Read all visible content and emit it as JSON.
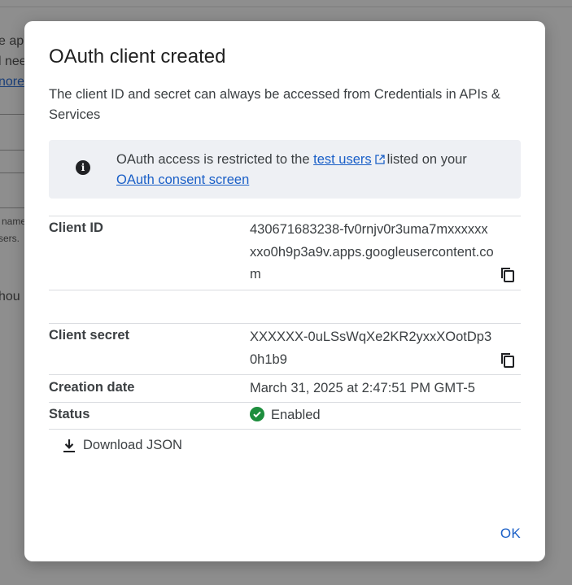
{
  "background": {
    "fragments": [
      "e ap",
      "l nee",
      "nore",
      "hou",
      "name",
      "sers."
    ]
  },
  "dialog": {
    "title": "OAuth client created",
    "description": "The client ID and secret can always be accessed from Credentials in APIs & Services",
    "notice": {
      "text_before": "OAuth access is restricted to the",
      "link1": "test users",
      "text_middle": "listed on your",
      "link2": "OAuth consent screen"
    },
    "client_id": {
      "label": "Client ID",
      "value": "430671683238-fv0rnjv0r3uma7mxxxxxxxxo0h9p3a9v.apps.googleusercontent.com"
    },
    "client_secret": {
      "label": "Client secret",
      "value": "XXXXXX-0uLSsWqXe2KR2yxxXOotDp30h1b9"
    },
    "creation_date": {
      "label": "Creation date",
      "value": "March 31, 2025 at 2:47:51 PM GMT-5"
    },
    "status": {
      "label": "Status",
      "value": "Enabled"
    },
    "download_label": "Download JSON",
    "ok_label": "OK"
  },
  "icons": {
    "info": "info-icon",
    "external_link": "external-link-icon",
    "copy": "copy-icon",
    "check": "check-circle-icon",
    "download": "download-icon"
  },
  "colors": {
    "accent": "#1a5fc7",
    "status_ok": "#1e8e3e",
    "notice_bg": "#eef0f4"
  }
}
